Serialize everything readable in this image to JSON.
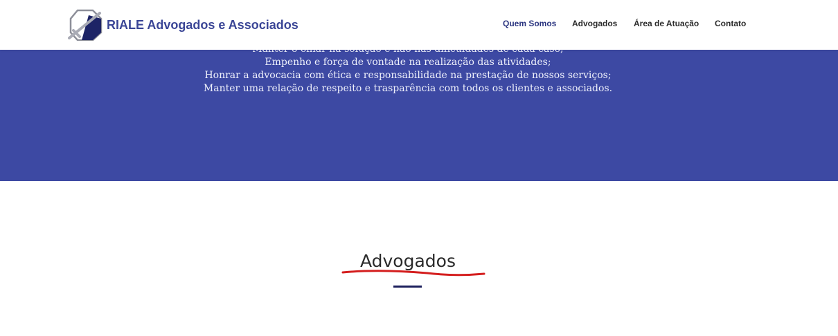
{
  "brand": {
    "name": "RIALE Advogados e Associados"
  },
  "nav": {
    "items": [
      {
        "label": "Quem Somos"
      },
      {
        "label": "Advogados"
      },
      {
        "label": "Área de Atuação"
      },
      {
        "label": "Contato"
      }
    ]
  },
  "values_section": {
    "lines": [
      "Manter o olhar na solução e não nas dificuldades de cada caso;",
      "Empenho e força de vontade na realização das atividades;",
      "Honrar a advocacia com ética e responsabilidade na prestação de nossos serviços;",
      "Manter uma relação de respeito e trasparência com todos os clientes e associados."
    ]
  },
  "lawyers_section": {
    "title": "Advogados"
  },
  "colors": {
    "brand_blue": "#3a4596",
    "section_blue": "#3d49a3",
    "annotation_red": "#d41e1e",
    "underline_navy": "#1b1f5c"
  }
}
